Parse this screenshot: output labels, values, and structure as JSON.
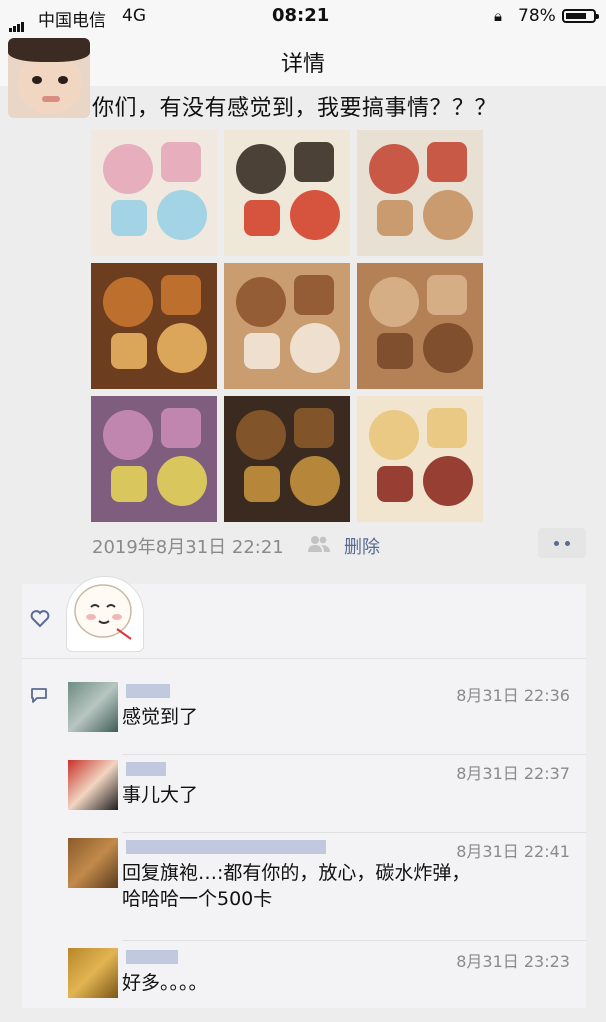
{
  "status": {
    "carrier": "中国电信",
    "network": "4G",
    "time": "08:21",
    "lock_icon": "rotation-lock-icon",
    "battery": "78%",
    "battery_level": 0.78
  },
  "nav": {
    "title": "详情"
  },
  "post": {
    "text": "你们，有没有感觉到，我要搞事情？？？",
    "photos": [
      {
        "name": "photo-mooncake-packets",
        "colors": [
          "#f1e9df",
          "#e6a9b9",
          "#9ad2e6"
        ]
      },
      {
        "name": "photo-yunnan-mooncake-bag",
        "colors": [
          "#efe7d8",
          "#3a2f26",
          "#d3422c"
        ]
      },
      {
        "name": "photo-flower-cake-bag",
        "colors": [
          "#e8e0d3",
          "#c44a37",
          "#c59363"
        ]
      },
      {
        "name": "photo-baked-mooncake",
        "colors": [
          "#6d3d1f",
          "#c5752f",
          "#e7b061"
        ]
      },
      {
        "name": "photo-mooncake-opened",
        "colors": [
          "#c99d70",
          "#8e5630",
          "#f2e7d8"
        ]
      },
      {
        "name": "photo-mooncake-collage",
        "colors": [
          "#b48056",
          "#d9b38c",
          "#7a4a2a"
        ]
      },
      {
        "name": "photo-snack-packages",
        "colors": [
          "#7e5d7f",
          "#c88bb5",
          "#e3d35b"
        ]
      },
      {
        "name": "photo-mooncake-cross-section",
        "colors": [
          "#3a2a20",
          "#8a5a2a",
          "#c4913d"
        ]
      },
      {
        "name": "photo-flower-cake-bite",
        "colors": [
          "#f1e5d0",
          "#e8c57b",
          "#8c2c20"
        ]
      }
    ],
    "date": "2019年8月31日 22:21",
    "delete_label": "删除",
    "people_icon": "people-icon",
    "more_icon": "more-dots-icon"
  },
  "likes": {
    "heart_icon": "heart-icon"
  },
  "comments_icon": "comment-icon",
  "comments": [
    {
      "time": "8月31日 22:36",
      "text": "感觉到了",
      "avatar_colors": [
        "#6e8d82",
        "#b9c6c2",
        "#3f5c55"
      ]
    },
    {
      "time": "8月31日 22:37",
      "text": "事儿大了",
      "avatar_colors": [
        "#c8312a",
        "#f1d5c1",
        "#1d1d1d"
      ]
    },
    {
      "time": "8月31日 22:41",
      "text": "回复旗袍…:都有你的，放心，碳水炸弹，哈哈哈一个500卡",
      "avatar_colors": [
        "#8a5a2c",
        "#c28a4a",
        "#5b3a1e"
      ]
    },
    {
      "time": "8月31日 23:23",
      "text": "好多。。。。",
      "avatar_colors": [
        "#b7862a",
        "#e2b552",
        "#7c5617"
      ]
    }
  ]
}
